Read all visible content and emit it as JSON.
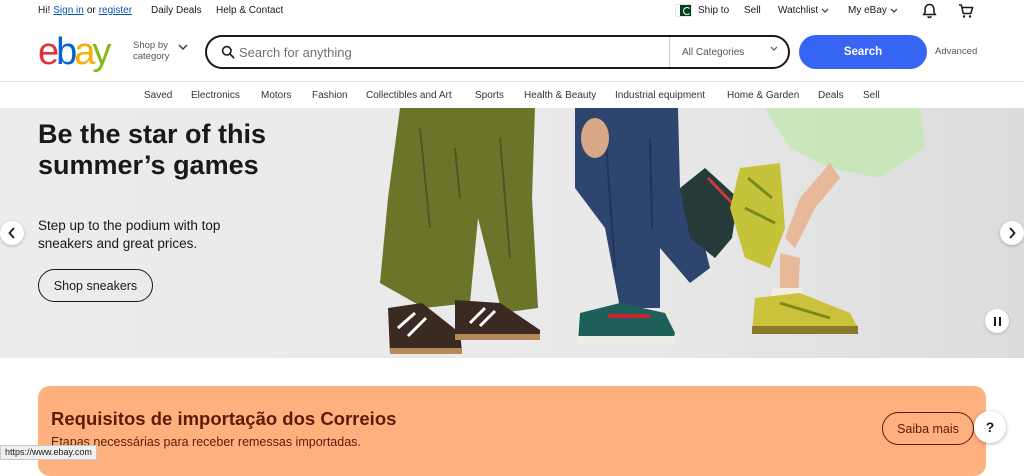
{
  "topbar": {
    "greeting": "Hi!",
    "sign_in": "Sign in",
    "or": "or",
    "register": "register",
    "daily_deals": "Daily Deals",
    "help_contact": "Help & Contact",
    "ship_to": "Ship to",
    "sell": "Sell",
    "watchlist": "Watchlist",
    "my_ebay": "My eBay"
  },
  "header": {
    "logo": {
      "e": "e",
      "b": "b",
      "a": "a",
      "y": "y"
    },
    "shop_by_line1": "Shop by",
    "shop_by_line2": "category",
    "search_placeholder": "Search for anything",
    "category_selected": "All Categories",
    "search_button": "Search",
    "advanced": "Advanced"
  },
  "nav": {
    "items": [
      "Saved",
      "Electronics",
      "Motors",
      "Fashion",
      "Collectibles and Art",
      "Sports",
      "Health & Beauty",
      "Industrial equipment",
      "Home & Garden",
      "Deals",
      "Sell"
    ]
  },
  "hero": {
    "title": "Be the star of this summer’s games",
    "subtitle": "Step up to the podium with top sneakers and great prices.",
    "cta": "Shop sneakers"
  },
  "banner": {
    "title": "Requisitos de importação dos Correios",
    "subtitle": "Etapas necessárias para receber remessas importadas.",
    "cta": "Saiba mais"
  },
  "help_label": "?",
  "status_url": "https://www.ebay.com",
  "colors": {
    "accent": "#3665f3",
    "banner_bg": "#ffb07f",
    "banner_text": "#5d1b08",
    "link": "#0654ba"
  },
  "icons": [
    "pakistan-flag-icon",
    "bell-icon",
    "cart-icon",
    "search-icon",
    "chevron-down-icon",
    "chevron-left-icon",
    "chevron-right-icon",
    "pause-icon"
  ]
}
